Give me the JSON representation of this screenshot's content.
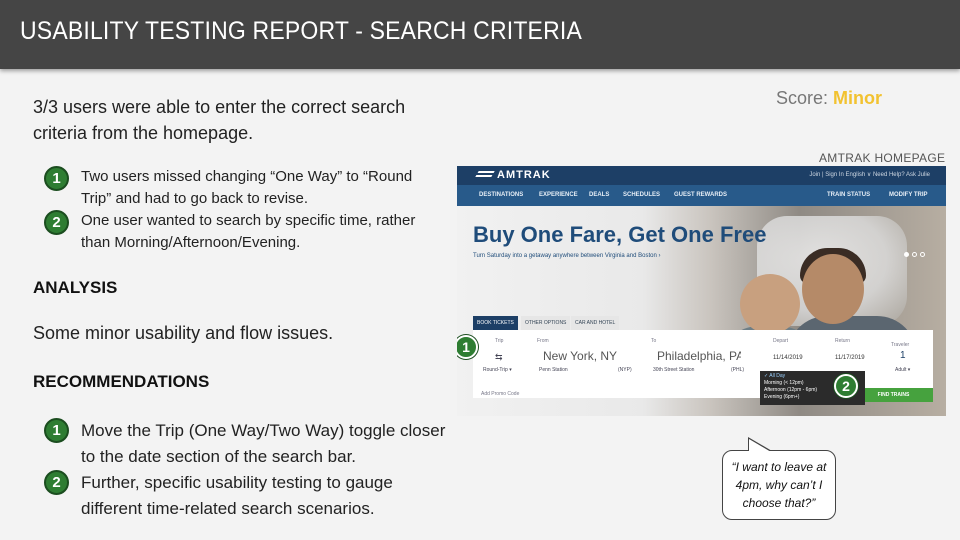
{
  "title": "USABILITY TESTING REPORT - SEARCH CRITERIA",
  "score": {
    "label": "Score:",
    "value": "Minor",
    "value_color": "#f2c230"
  },
  "summary": "3/3 users were able to enter the correct search criteria from the homepage.",
  "findings": [
    {
      "number": "1",
      "text": "Two users missed changing “One Way” to “Round Trip” and had to go back to revise."
    },
    {
      "number": "2",
      "text": "One user wanted to search by specific time, rather than Morning/Afternoon/Evening."
    }
  ],
  "analysis": {
    "heading": "ANALYSIS",
    "text": "Some minor usability and flow issues."
  },
  "recommendations": {
    "heading": "RECOMMENDATIONS",
    "items": [
      {
        "number": "1",
        "text": "Move the Trip (One Way/Two Way) toggle closer to the date section of the search bar."
      },
      {
        "number": "2",
        "text": "Further, specific usability testing to gauge different time-related search scenarios."
      }
    ]
  },
  "screenshot": {
    "caption": "AMTRAK HOMEPAGE",
    "logo": "AMTRAK",
    "toplinks": "Join | Sign In   English ∨   Need Help? Ask Julie",
    "nav": [
      "DESTINATIONS",
      "EXPERIENCE",
      "DEALS",
      "SCHEDULES",
      "GUEST REWARDS",
      "TRAIN STATUS",
      "MODIFY TRIP"
    ],
    "headline": "Buy One Fare, Get One Free",
    "subline": "Turn Saturday into a getaway anywhere between Virginia and Boston ›",
    "tabs": [
      "BOOK TICKETS",
      "OTHER OPTIONS",
      "CAR AND HOTEL"
    ],
    "form": {
      "trip_label": "Trip",
      "trip_value": "Round-Trip ▾",
      "from_label": "From",
      "from_value": "New York, NY",
      "from_sub": "Penn Station",
      "from_code": "(NYP)",
      "to_label": "To",
      "to_value": "Philadelphia, PA",
      "to_sub": "30th Street Station",
      "to_code": "(PHL)",
      "depart_label": "Depart",
      "depart_value": "11/14/2019",
      "return_label": "Return",
      "return_value": "11/17/2019",
      "traveler_label": "Traveler",
      "traveler_value": "1",
      "traveler_type": "Adult ▾",
      "promo": "Add Promo Code",
      "find_button": "FIND TRAINS"
    },
    "time_options": [
      "✓ All Day",
      "Morning (< 12pm)",
      "Afternoon (12pm - 6pm)",
      "Evening (6pm+)"
    ],
    "badges": [
      "1",
      "2"
    ]
  },
  "quote": "“I want to leave at 4pm, why can’t I choose that?”",
  "colors": {
    "title_bar": "#454545",
    "badge_green": "#2e7d32",
    "amtrak_blue": "#1d3f66",
    "find_green": "#46a23e"
  }
}
